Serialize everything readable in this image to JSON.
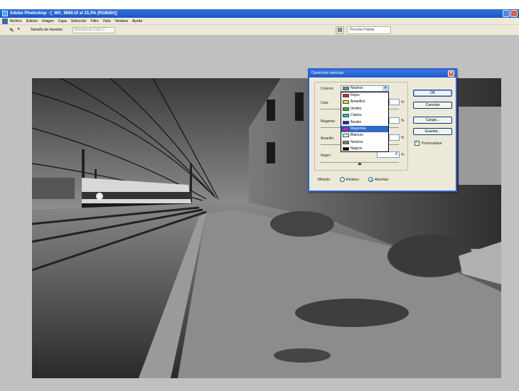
{
  "window": {
    "title": "Adobe Photoshop - [_MG_9856.tif al 33,3% (RGB/8#)]"
  },
  "menu": {
    "items": [
      "Archivo",
      "Edición",
      "Imagen",
      "Capa",
      "Selección",
      "Filtro",
      "Vista",
      "Ventana",
      "Ayuda"
    ]
  },
  "options": {
    "sample_label": "Tamaño de muestra:",
    "sample_value": "Muestra de 3 por 3",
    "palette_tab": "Pinceles   Paleta"
  },
  "dialog": {
    "title": "Corrección selectiva",
    "colores_label": "Colores:",
    "colores_value": "Neutros",
    "options": [
      {
        "label": "Rojos",
        "color": "#e02020"
      },
      {
        "label": "Amarillos",
        "color": "#f0e020"
      },
      {
        "label": "Verdes",
        "color": "#20c020"
      },
      {
        "label": "Cianes",
        "color": "#20c0c0"
      },
      {
        "label": "Azules",
        "color": "#2020e0"
      },
      {
        "label": "Magentas",
        "color": "#d020d0"
      },
      {
        "label": "Blancos",
        "color": "#ffffff"
      },
      {
        "label": "Neutros",
        "color": "#808080"
      },
      {
        "label": "Negros",
        "color": "#000000"
      }
    ],
    "selected_option": "Magentas",
    "cian_label": "Cian:",
    "magenta_label": "Magenta:",
    "amarillo_label": "Amarillo:",
    "negro_label": "Negro:",
    "negro_value": "0",
    "pct": "%",
    "btn_ok": "OK",
    "btn_cancel": "Cancelar",
    "btn_load": "Cargar...",
    "btn_save": "Guardar...",
    "preview_label": "Previsualizar",
    "preview_checked": true,
    "metodo_label": "Método:",
    "relativo_label": "Relativo",
    "absoluto_label": "Absoluto",
    "metodo_selected": "Absoluto"
  }
}
